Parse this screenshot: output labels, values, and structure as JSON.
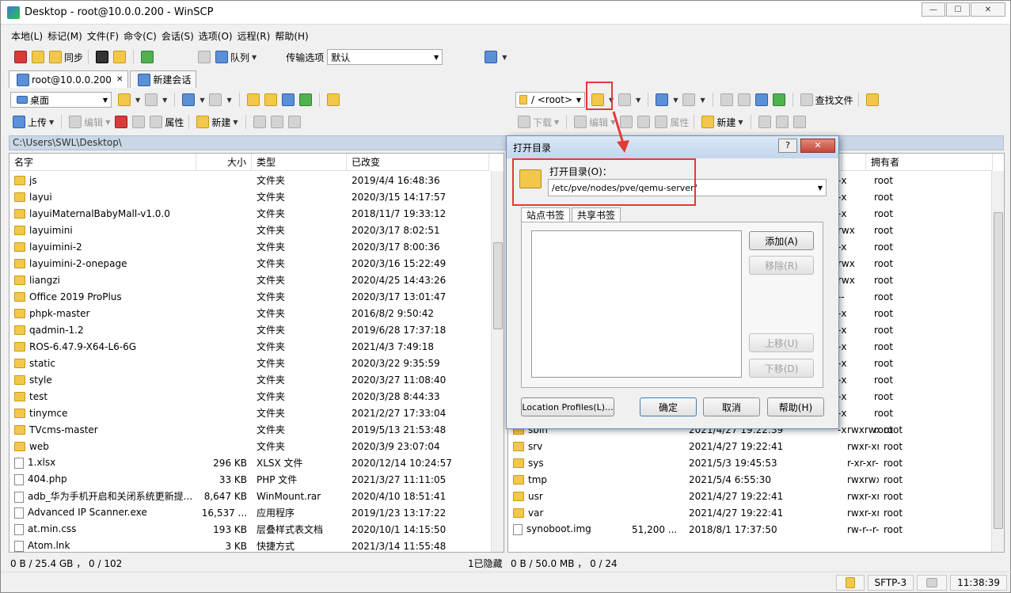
{
  "window": {
    "title": "Desktop - root@10.0.0.200 - WinSCP",
    "min": "—",
    "max": "☐",
    "close": "✕"
  },
  "menu": [
    "本地(L)",
    "标记(M)",
    "文件(F)",
    "命令(C)",
    "会话(S)",
    "选项(O)",
    "远程(R)",
    "帮助(H)"
  ],
  "toolbar": {
    "sync": "同步",
    "queue": "队列",
    "transfer_label": "传输选项",
    "transfer_value": "默认"
  },
  "tabs": [
    {
      "label": "root@10.0.0.200",
      "close": "✕"
    },
    {
      "label": "新建会话"
    }
  ],
  "left": {
    "location": "桌面",
    "upload": "上传",
    "edit": "编辑",
    "props": "属性",
    "new": "新建",
    "path": "C:\\Users\\SWL\\Desktop\\",
    "headers": [
      "名字",
      "大小",
      "类型",
      "已改变"
    ],
    "rows": [
      {
        "name": "js",
        "size": "",
        "type": "文件夹",
        "date": "2019/4/4  16:48:36",
        "kind": "folder"
      },
      {
        "name": "layui",
        "size": "",
        "type": "文件夹",
        "date": "2020/3/15  14:17:57",
        "kind": "folder"
      },
      {
        "name": "layuiMaternalBabyMall-v1.0.0",
        "size": "",
        "type": "文件夹",
        "date": "2018/11/7  19:33:12",
        "kind": "folder"
      },
      {
        "name": "layuimini",
        "size": "",
        "type": "文件夹",
        "date": "2020/3/17  8:02:51",
        "kind": "folder"
      },
      {
        "name": "layuimini-2",
        "size": "",
        "type": "文件夹",
        "date": "2020/3/17  8:00:36",
        "kind": "folder"
      },
      {
        "name": "layuimini-2-onepage",
        "size": "",
        "type": "文件夹",
        "date": "2020/3/16  15:22:49",
        "kind": "folder"
      },
      {
        "name": "liangzi",
        "size": "",
        "type": "文件夹",
        "date": "2020/4/25  14:43:26",
        "kind": "folder"
      },
      {
        "name": "Office 2019 ProPlus",
        "size": "",
        "type": "文件夹",
        "date": "2020/3/17  13:01:47",
        "kind": "folder"
      },
      {
        "name": "phpk-master",
        "size": "",
        "type": "文件夹",
        "date": "2016/8/2  9:50:42",
        "kind": "folder"
      },
      {
        "name": "qadmin-1.2",
        "size": "",
        "type": "文件夹",
        "date": "2019/6/28  17:37:18",
        "kind": "folder"
      },
      {
        "name": "ROS-6.47.9-X64-L6-6G",
        "size": "",
        "type": "文件夹",
        "date": "2021/4/3  7:49:18",
        "kind": "folder"
      },
      {
        "name": "static",
        "size": "",
        "type": "文件夹",
        "date": "2020/3/22  9:35:59",
        "kind": "folder"
      },
      {
        "name": "style",
        "size": "",
        "type": "文件夹",
        "date": "2020/3/27  11:08:40",
        "kind": "folder"
      },
      {
        "name": "test",
        "size": "",
        "type": "文件夹",
        "date": "2020/3/28  8:44:33",
        "kind": "folder"
      },
      {
        "name": "tinymce",
        "size": "",
        "type": "文件夹",
        "date": "2021/2/27  17:33:04",
        "kind": "folder"
      },
      {
        "name": "TVcms-master",
        "size": "",
        "type": "文件夹",
        "date": "2019/5/13  21:53:48",
        "kind": "folder"
      },
      {
        "name": "web",
        "size": "",
        "type": "文件夹",
        "date": "2020/3/9  23:07:04",
        "kind": "folder"
      },
      {
        "name": "1.xlsx",
        "size": "296 KB",
        "type": "XLSX 文件",
        "date": "2020/12/14  10:24:57",
        "kind": "file"
      },
      {
        "name": "404.php",
        "size": "33 KB",
        "type": "PHP 文件",
        "date": "2021/3/27  11:11:05",
        "kind": "file"
      },
      {
        "name": "adb_华为手机开启和关闭系统更新提...",
        "size": "8,647 KB",
        "type": "WinMount.rar",
        "date": "2020/4/10  18:51:41",
        "kind": "file"
      },
      {
        "name": "Advanced IP Scanner.exe",
        "size": "16,537 ...",
        "type": "应用程序",
        "date": "2019/1/23  13:17:22",
        "kind": "file"
      },
      {
        "name": "at.min.css",
        "size": "193 KB",
        "type": "层叠样式表文档",
        "date": "2020/10/1  14:15:50",
        "kind": "file"
      },
      {
        "name": "Atom.lnk",
        "size": "3 KB",
        "type": "快捷方式",
        "date": "2021/3/14  11:55:48",
        "kind": "file"
      }
    ],
    "status": "0 B / 25.4 GB ，  0 / 102"
  },
  "right": {
    "location": "/ <root>",
    "download": "下载",
    "edit": "编辑",
    "props": "属性",
    "new": "新建",
    "find": "查找文件",
    "owner_header": "拥有者",
    "top_rows": [
      {
        "perm": "-x",
        "owner": "root"
      },
      {
        "perm": "-x",
        "owner": "root"
      },
      {
        "perm": "-x",
        "owner": "root"
      },
      {
        "perm": "rwx",
        "owner": "root"
      },
      {
        "perm": "-x",
        "owner": "root"
      },
      {
        "perm": "rwx",
        "owner": "root"
      },
      {
        "perm": "rwx",
        "owner": "root"
      },
      {
        "perm": "--",
        "owner": "root"
      },
      {
        "perm": "-x",
        "owner": "root"
      },
      {
        "perm": "-x",
        "owner": "root"
      },
      {
        "perm": "-x",
        "owner": "root"
      },
      {
        "perm": "-x",
        "owner": "root"
      },
      {
        "perm": "-x",
        "owner": "root"
      },
      {
        "perm": "-x",
        "owner": "root"
      },
      {
        "perm": "-x",
        "owner": "root"
      },
      {
        "perm": "-x",
        "owner": "root"
      }
    ],
    "rows": [
      {
        "name": "sbin",
        "size": "",
        "date": "2021/4/27  19:22:39",
        "perm": "rwxrwxrwx",
        "owner": "root",
        "kind": "folder"
      },
      {
        "name": "srv",
        "size": "",
        "date": "2021/4/27  19:22:41",
        "perm": "rwxr-xr-x",
        "owner": "root",
        "kind": "folder"
      },
      {
        "name": "sys",
        "size": "",
        "date": "2021/5/3  19:45:53",
        "perm": "r-xr-xr-x",
        "owner": "root",
        "kind": "folder"
      },
      {
        "name": "tmp",
        "size": "",
        "date": "2021/5/4  6:55:30",
        "perm": "rwxrwxrwt",
        "owner": "root",
        "kind": "folder"
      },
      {
        "name": "usr",
        "size": "",
        "date": "2021/4/27  19:22:41",
        "perm": "rwxr-xr-x",
        "owner": "root",
        "kind": "folder"
      },
      {
        "name": "var",
        "size": "",
        "date": "2021/4/27  19:22:41",
        "perm": "rwxr-xr-x",
        "owner": "root",
        "kind": "folder"
      },
      {
        "name": "synoboot.img",
        "size": "51,200 ...",
        "date": "2018/8/1  17:37:50",
        "perm": "rw-r--r--",
        "owner": "root",
        "kind": "file"
      }
    ],
    "hidden": "1已隐藏",
    "status": "0 B / 50.0 MB ，  0 / 24"
  },
  "bottom": {
    "protocol": "SFTP-3",
    "time": "11:38:39"
  },
  "dialog": {
    "title": "打开目录",
    "help": "?",
    "close": "✕",
    "label": "打开目录(O)：",
    "path": "/etc/pve/nodes/pve/qemu-server/",
    "tabs": [
      "站点书签",
      "共享书签"
    ],
    "add": "添加(A)",
    "remove": "移除(R)",
    "up": "上移(U)",
    "down": "下移(D)",
    "profiles": "Location Profiles(L)...",
    "ok": "确定",
    "cancel": "取消",
    "helpbtn": "帮助(H)"
  }
}
